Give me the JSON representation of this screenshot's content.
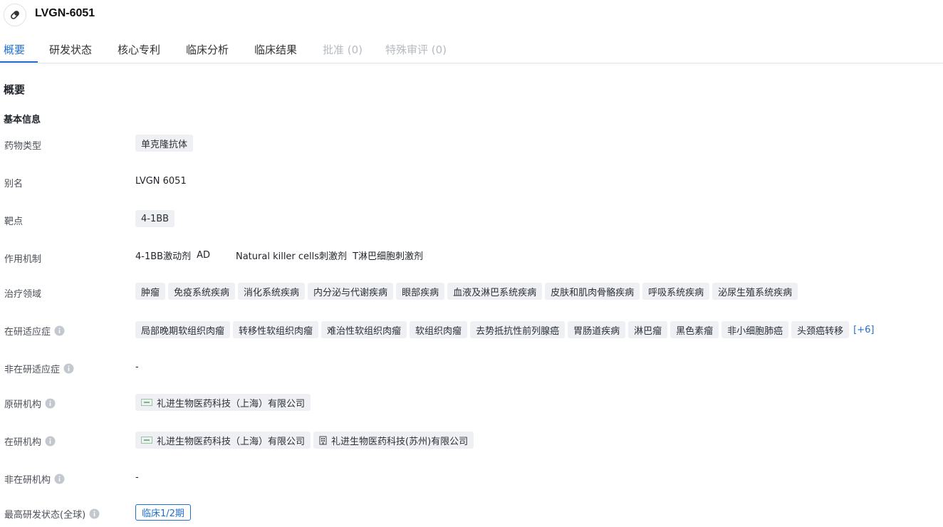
{
  "header": {
    "title": "LVGN-6051",
    "icon": "pill-icon"
  },
  "tabs": [
    {
      "label": "概要",
      "state": "active"
    },
    {
      "label": "研发状态",
      "state": "normal"
    },
    {
      "label": "核心专利",
      "state": "normal"
    },
    {
      "label": "临床分析",
      "state": "normal"
    },
    {
      "label": "临床结果",
      "state": "normal"
    },
    {
      "label": "批准 (0)",
      "state": "disabled"
    },
    {
      "label": "特殊审评 (0)",
      "state": "disabled"
    }
  ],
  "overview": {
    "section_title": "概要",
    "basic_info_title": "基本信息",
    "drug_type": {
      "label": "药物类型",
      "tag": "单克隆抗体"
    },
    "alias": {
      "label": "别名",
      "value": "LVGN 6051"
    },
    "target": {
      "label": "靶点",
      "tag": "4-1BB"
    },
    "mechanism": {
      "label": "作用机制",
      "items": [
        "4-1BB激动剂",
        "AD",
        "Natural killer cells刺激剂",
        "T淋巴细胞刺激剂"
      ]
    },
    "therapeutic_areas": {
      "label": "治疗领域",
      "tags": [
        "肿瘤",
        "免疫系统疾病",
        "消化系统疾病",
        "内分泌与代谢疾病",
        "眼部疾病",
        "血液及淋巴系统疾病",
        "皮肤和肌肉骨骼疾病",
        "呼吸系统疾病",
        "泌尿生殖系统疾病"
      ]
    },
    "active_indications": {
      "label": "在研适应症",
      "tags": [
        "局部晚期软组织肉瘤",
        "转移性软组织肉瘤",
        "难治性软组织肉瘤",
        "软组织肉瘤",
        "去势抵抗性前列腺癌",
        "胃肠道疾病",
        "淋巴瘤",
        "黑色素瘤",
        "非小细胞肺癌",
        "头颈癌转移"
      ],
      "more": "[+6]"
    },
    "inactive_indications": {
      "label": "非在研适应症",
      "value": "-"
    },
    "originator": {
      "label": "原研机构",
      "orgs": [
        "礼进生物医药科技（上海）有限公司"
      ]
    },
    "active_orgs": {
      "label": "在研机构",
      "orgs": [
        "礼进生物医药科技（上海）有限公司",
        "礼进生物医药科技(苏州)有限公司"
      ]
    },
    "inactive_orgs": {
      "label": "非在研机构",
      "value": "-"
    },
    "highest_phase": {
      "label": "最高研发状态(全球)",
      "value": "临床1/2期"
    }
  },
  "colors": {
    "accent": "#1f6fd1",
    "tag_bg": "#eef0f3",
    "disabled": "#b6bac1"
  }
}
